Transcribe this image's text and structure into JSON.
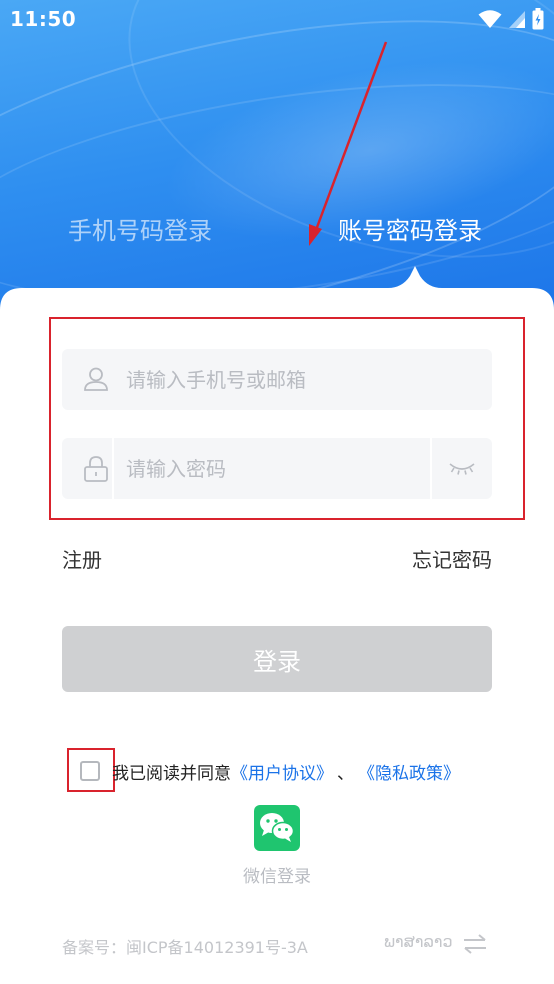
{
  "status_bar": {
    "time": "11:50"
  },
  "tabs": {
    "phone_login": "手机号码登录",
    "account_login": "账号密码登录"
  },
  "form": {
    "username_placeholder": "请输入手机号或邮箱",
    "password_placeholder": "请输入密码"
  },
  "links": {
    "register": "注册",
    "forgot_password": "忘记密码"
  },
  "login_button": "登录",
  "agreement": {
    "prefix": "我已阅读并同意",
    "user_agreement": "《用户协议》",
    "separator": "、",
    "privacy_policy": "《隐私政策》"
  },
  "wechat_login": "微信登录",
  "footer": {
    "icp": "备案号：闽ICP备14012391号-3A",
    "language": "ພາສາລາວ"
  },
  "colors": {
    "header_blue": "#2f8ff0",
    "link_blue": "#1b73e8",
    "annotation_red": "#d9232d",
    "wechat_green": "#1fc56f",
    "disabled_button": "#cfd0d2"
  },
  "icons": [
    "wifi-icon",
    "cellular-icon",
    "battery-icon",
    "user-icon",
    "lock-icon",
    "eye-closed-icon",
    "wechat-icon",
    "switch-language-icon"
  ]
}
